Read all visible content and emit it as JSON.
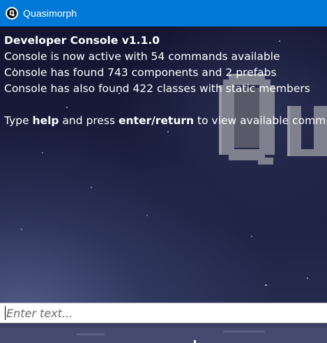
{
  "window": {
    "title": "Quasimorph",
    "icon": "quasimorph-q-icon",
    "titlebar_color": "#0078d7"
  },
  "console": {
    "header": "Developer Console v1.1.0",
    "lines": [
      "Console is now active with 54 commands available",
      "Console has found 743 components and 2 prefabs",
      "Console has also found 422 classes with static members"
    ],
    "hint": {
      "prefix": "Type ",
      "command": "help",
      "middle": " and press ",
      "key": "enter/return",
      "suffix": " to view available comm"
    },
    "text_color": "#ffffff"
  },
  "input": {
    "placeholder": "Enter text...",
    "value": ""
  },
  "background": {
    "logo_text": "Qu"
  }
}
